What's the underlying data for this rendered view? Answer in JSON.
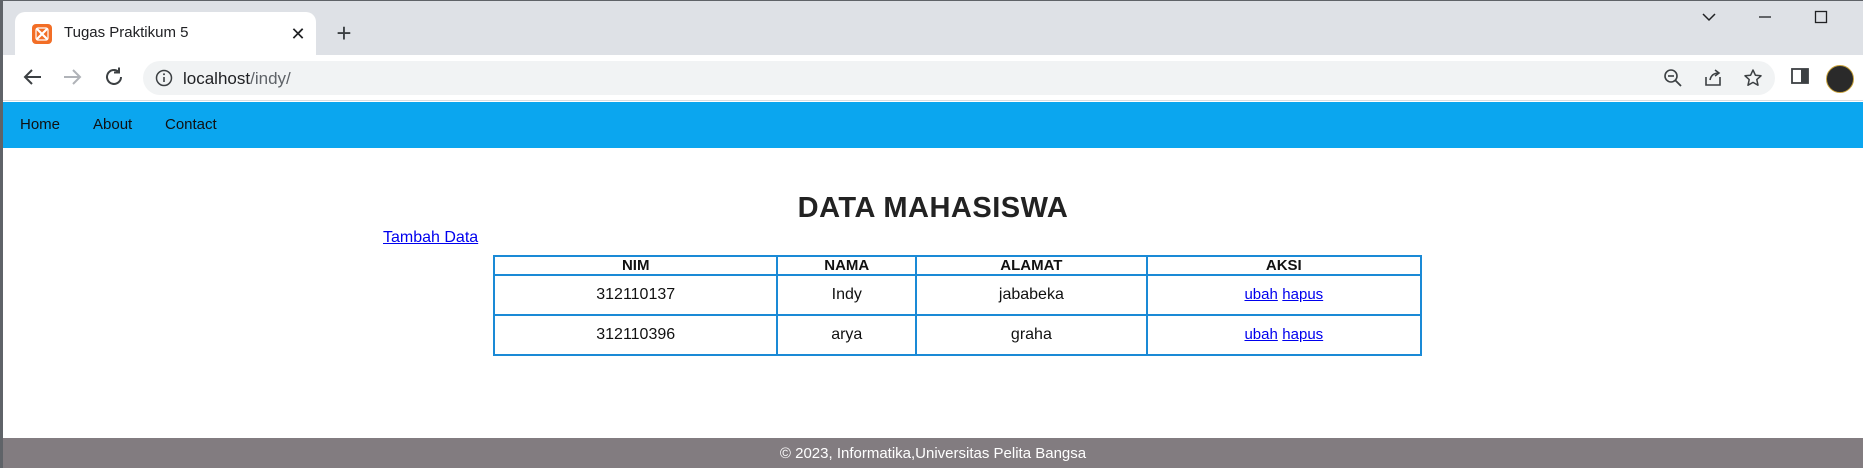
{
  "browser": {
    "tab_title": "Tugas Praktikum 5",
    "url_host": "localhost",
    "url_path": "/indy/"
  },
  "nav": {
    "items": [
      {
        "label": "Home"
      },
      {
        "label": "About"
      },
      {
        "label": "Contact"
      }
    ]
  },
  "main": {
    "title": "DATA MAHASISWA",
    "add_link": "Tambah Data",
    "table": {
      "headers": [
        "NIM",
        "NAMA",
        "ALAMAT",
        "AKSI"
      ],
      "rows": [
        {
          "nim": "312110137",
          "nama": "Indy",
          "alamat": "jababeka",
          "edit": "ubah",
          "delete": "hapus"
        },
        {
          "nim": "312110396",
          "nama": "arya",
          "alamat": "graha",
          "edit": "ubah",
          "delete": "hapus"
        }
      ]
    }
  },
  "footer": {
    "text": "© 2023, Informatika,Universitas Pelita Bangsa"
  },
  "colors": {
    "navbar": "#0ba6ef",
    "footer": "#827c80",
    "table_border": "#1a8ad6",
    "link": "#0000ee"
  }
}
